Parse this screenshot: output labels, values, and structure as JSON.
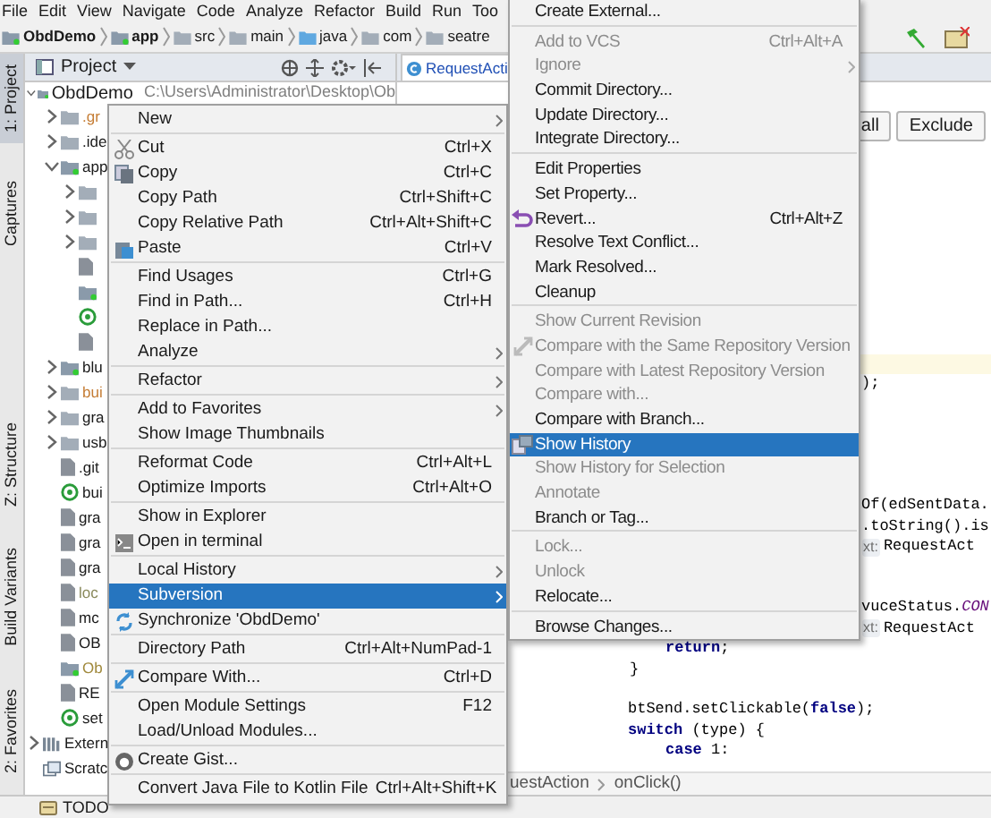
{
  "menu_bar": [
    "File",
    "Edit",
    "View",
    "Navigate",
    "Code",
    "Analyze",
    "Refactor",
    "Build",
    "Run",
    "Too"
  ],
  "breadcrumbs": [
    {
      "label": "ObdDemo",
      "kind": "module"
    },
    {
      "label": "app",
      "kind": "module"
    },
    {
      "label": "src",
      "kind": "folder"
    },
    {
      "label": "main",
      "kind": "folder"
    },
    {
      "label": "java",
      "kind": "source"
    },
    {
      "label": "com",
      "kind": "folder"
    },
    {
      "label": "seatre",
      "kind": "folder"
    }
  ],
  "left_toolbar": [
    {
      "label": "1: Project",
      "selected": true
    },
    {
      "label": "Captures",
      "selected": false
    },
    {
      "label": "Z: Structure",
      "selected": false
    },
    {
      "label": "Build Variants",
      "selected": false
    },
    {
      "label": "2: Favorites",
      "selected": false
    }
  ],
  "project_panel": {
    "title": "Project",
    "tree": [
      {
        "label": "ObdDemo",
        "path": "C:\\Users\\Administrator\\Desktop\\Ob",
        "kind": "module",
        "expanded": true,
        "children": [
          {
            "label": ".gr",
            "kind": "folder",
            "expanded": false,
            "color": "#c57d35"
          },
          {
            "label": ".ide",
            "kind": "folder",
            "expanded": false
          },
          {
            "label": "app",
            "kind": "module",
            "expanded": true,
            "children": [
              {
                "kind": "folder",
                "expanded": false
              },
              {
                "kind": "folder",
                "expanded": false
              },
              {
                "kind": "folder",
                "expanded": false
              },
              {
                "kind": "file"
              },
              {
                "kind": "module"
              },
              {
                "kind": "gradle"
              },
              {
                "kind": "file"
              }
            ]
          },
          {
            "label": "blu",
            "kind": "module",
            "expanded": false
          },
          {
            "label": "bui",
            "kind": "folder",
            "expanded": false,
            "color": "#c57d35"
          },
          {
            "label": "gra",
            "kind": "folder",
            "expanded": false
          },
          {
            "label": "usb",
            "kind": "folder",
            "expanded": false
          },
          {
            "label": ".git",
            "kind": "file"
          },
          {
            "label": "bui",
            "kind": "gradle"
          },
          {
            "label": "gra",
            "kind": "file"
          },
          {
            "label": "gra",
            "kind": "file"
          },
          {
            "label": "gra",
            "kind": "file"
          },
          {
            "label": "loc",
            "kind": "file",
            "color": "#8a8a5c"
          },
          {
            "label": "mc",
            "kind": "file"
          },
          {
            "label": "OB",
            "kind": "file"
          },
          {
            "label": "Ob",
            "kind": "module",
            "color": "#a0893c"
          },
          {
            "label": "RE",
            "kind": "file"
          },
          {
            "label": "set",
            "kind": "gradle"
          }
        ]
      },
      {
        "label": "Extern",
        "kind": "library",
        "expanded": false
      },
      {
        "label": "Scratc",
        "kind": "scratch"
      }
    ]
  },
  "editor": {
    "tab": "RequestActi",
    "buttons": [
      "all",
      "Exclude"
    ],
    "lines": [
      {
        "text": ");"
      },
      {
        "text": "Of(edSentData."
      },
      {
        "text": ".toString().is"
      },
      {
        "hint": "xt:",
        "text": "RequestAct"
      },
      {
        "text": "vuceStatus.*CON*"
      },
      {
        "hint": "xt:",
        "text": "RequestAct"
      },
      {
        "text": "**return**;"
      },
      {
        "text": "}"
      },
      {
        "text": "btSend.setClickable(**false**);"
      },
      {
        "text": "**switch** (type) {"
      },
      {
        "text": "**case** 1:"
      }
    ],
    "breadcrumb": [
      "uestAction",
      "onClick()"
    ]
  },
  "status_bar": {
    "todo": "TODO"
  },
  "context_menu": [
    [
      {
        "label": "New",
        "has_submenu": true,
        "selected": false
      }
    ],
    [
      {
        "label": "Cut",
        "shortcut": "Ctrl+X",
        "selected": false
      },
      {
        "label": "Copy",
        "shortcut": "Ctrl+C",
        "selected": false
      },
      {
        "label": "Copy Path",
        "shortcut": "Ctrl+Shift+C",
        "selected": false
      },
      {
        "label": "Copy Relative Path",
        "shortcut": "Ctrl+Alt+Shift+C",
        "selected": false
      },
      {
        "label": "Paste",
        "shortcut": "Ctrl+V",
        "selected": false
      }
    ],
    [
      {
        "label": "Find Usages",
        "shortcut": "Ctrl+G",
        "selected": false
      },
      {
        "label": "Find in Path...",
        "shortcut": "Ctrl+H",
        "selected": false
      },
      {
        "label": "Replace in Path...",
        "selected": false
      },
      {
        "label": "Analyze",
        "has_submenu": true,
        "selected": false
      }
    ],
    [
      {
        "label": "Refactor",
        "has_submenu": true,
        "selected": false
      }
    ],
    [
      {
        "label": "Add to Favorites",
        "has_submenu": true,
        "selected": false
      },
      {
        "label": "Show Image Thumbnails",
        "selected": false
      }
    ],
    [
      {
        "label": "Reformat Code",
        "shortcut": "Ctrl+Alt+L",
        "selected": false
      },
      {
        "label": "Optimize Imports",
        "shortcut": "Ctrl+Alt+O",
        "selected": false
      }
    ],
    [
      {
        "label": "Show in Explorer",
        "selected": false
      },
      {
        "label": "Open in terminal",
        "selected": false
      }
    ],
    [
      {
        "label": "Local History",
        "has_submenu": true,
        "selected": false
      },
      {
        "label": "Subversion",
        "has_submenu": true,
        "selected": true
      },
      {
        "label": "Synchronize 'ObdDemo'",
        "selected": false
      }
    ],
    [
      {
        "label": "Directory Path",
        "shortcut": "Ctrl+Alt+NumPad-1",
        "selected": false
      }
    ],
    [
      {
        "label": "Compare With...",
        "shortcut": "Ctrl+D",
        "selected": false
      }
    ],
    [
      {
        "label": "Open Module Settings",
        "shortcut": "F12",
        "selected": false
      },
      {
        "label": "Load/Unload Modules...",
        "selected": false
      }
    ],
    [
      {
        "label": "Create Gist...",
        "selected": false
      }
    ],
    [
      {
        "label": "Convert Java File to Kotlin File",
        "shortcut": "Ctrl+Alt+Shift+K",
        "selected": false
      }
    ]
  ],
  "subversion_menu": [
    [
      {
        "label": "Create External...",
        "disabled": false,
        "selected": false
      }
    ],
    [
      {
        "label": "Add to VCS",
        "shortcut": "Ctrl+Alt+A",
        "disabled": true,
        "selected": false
      },
      {
        "label": "Ignore",
        "has_submenu": true,
        "disabled": true,
        "selected": false
      },
      {
        "label": "Commit Directory...",
        "disabled": false,
        "selected": false
      },
      {
        "label": "Update Directory...",
        "disabled": false,
        "selected": false
      },
      {
        "label": "Integrate Directory...",
        "disabled": false,
        "selected": false
      }
    ],
    [
      {
        "label": "Edit Properties",
        "disabled": false,
        "selected": false
      },
      {
        "label": "Set Property...",
        "disabled": false,
        "selected": false
      },
      {
        "label": "Revert...",
        "shortcut": "Ctrl+Alt+Z",
        "disabled": false,
        "selected": false
      },
      {
        "label": "Resolve Text Conflict...",
        "disabled": false,
        "selected": false
      },
      {
        "label": "Mark Resolved...",
        "disabled": false,
        "selected": false
      },
      {
        "label": "Cleanup",
        "disabled": false,
        "selected": false
      }
    ],
    [
      {
        "label": "Show Current Revision",
        "disabled": true,
        "selected": false
      },
      {
        "label": "Compare with the Same Repository Version",
        "disabled": true,
        "selected": false
      },
      {
        "label": "Compare with Latest Repository Version",
        "disabled": true,
        "selected": false
      },
      {
        "label": "Compare with...",
        "disabled": true,
        "selected": false
      },
      {
        "label": "Compare with Branch...",
        "disabled": false,
        "selected": false
      },
      {
        "label": "Show History",
        "disabled": false,
        "selected": true
      },
      {
        "label": "Show History for Selection",
        "disabled": true,
        "selected": false
      },
      {
        "label": "Annotate",
        "disabled": true,
        "selected": false
      },
      {
        "label": "Branch or Tag...",
        "disabled": false,
        "selected": false
      }
    ],
    [
      {
        "label": "Lock...",
        "disabled": true,
        "selected": false
      },
      {
        "label": "Unlock",
        "disabled": true,
        "selected": false
      },
      {
        "label": "Relocate...",
        "disabled": false,
        "selected": false
      }
    ],
    [
      {
        "label": "Browse Changes...",
        "disabled": false,
        "selected": false
      }
    ]
  ]
}
